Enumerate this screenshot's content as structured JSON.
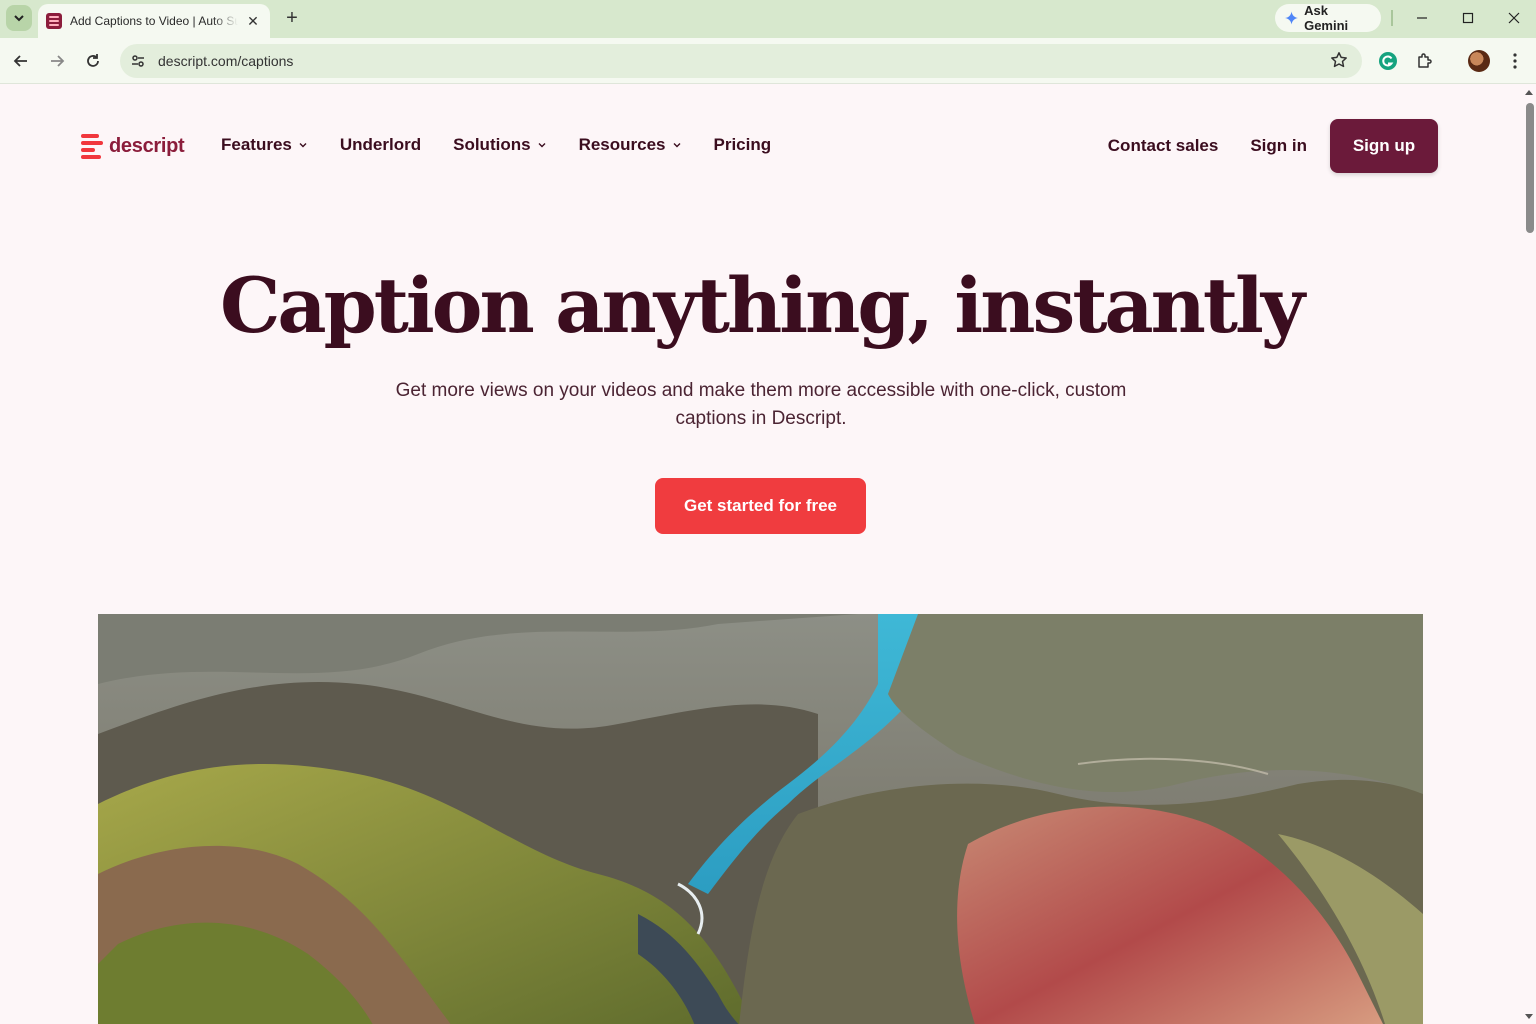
{
  "browser": {
    "tab_title": "Add Captions to Video | Auto Subtitle Generator",
    "close_glyph": "✕",
    "new_tab_glyph": "+",
    "gemini_label": "Ask Gemini",
    "url": "descript.com/captions"
  },
  "nav": {
    "logo_text": "descript",
    "items": [
      {
        "label": "Features",
        "has_dropdown": true
      },
      {
        "label": "Underlord",
        "has_dropdown": false
      },
      {
        "label": "Solutions",
        "has_dropdown": true
      },
      {
        "label": "Resources",
        "has_dropdown": true
      },
      {
        "label": "Pricing",
        "has_dropdown": false
      }
    ],
    "contact_sales": "Contact sales",
    "sign_in": "Sign in",
    "sign_up": "Sign up"
  },
  "hero": {
    "title": "Caption anything, instantly",
    "subtitle": "Get more views on your videos and make them more accessible with one-click, custom captions in Descript.",
    "cta": "Get started for free",
    "media_icon": "aerial-landscape-image"
  },
  "colors": {
    "brand_maroon": "#6b1a3a",
    "cta_red": "#f03c3f",
    "page_bg": "#fdf6f8",
    "chrome_green": "#d7e8cd"
  }
}
